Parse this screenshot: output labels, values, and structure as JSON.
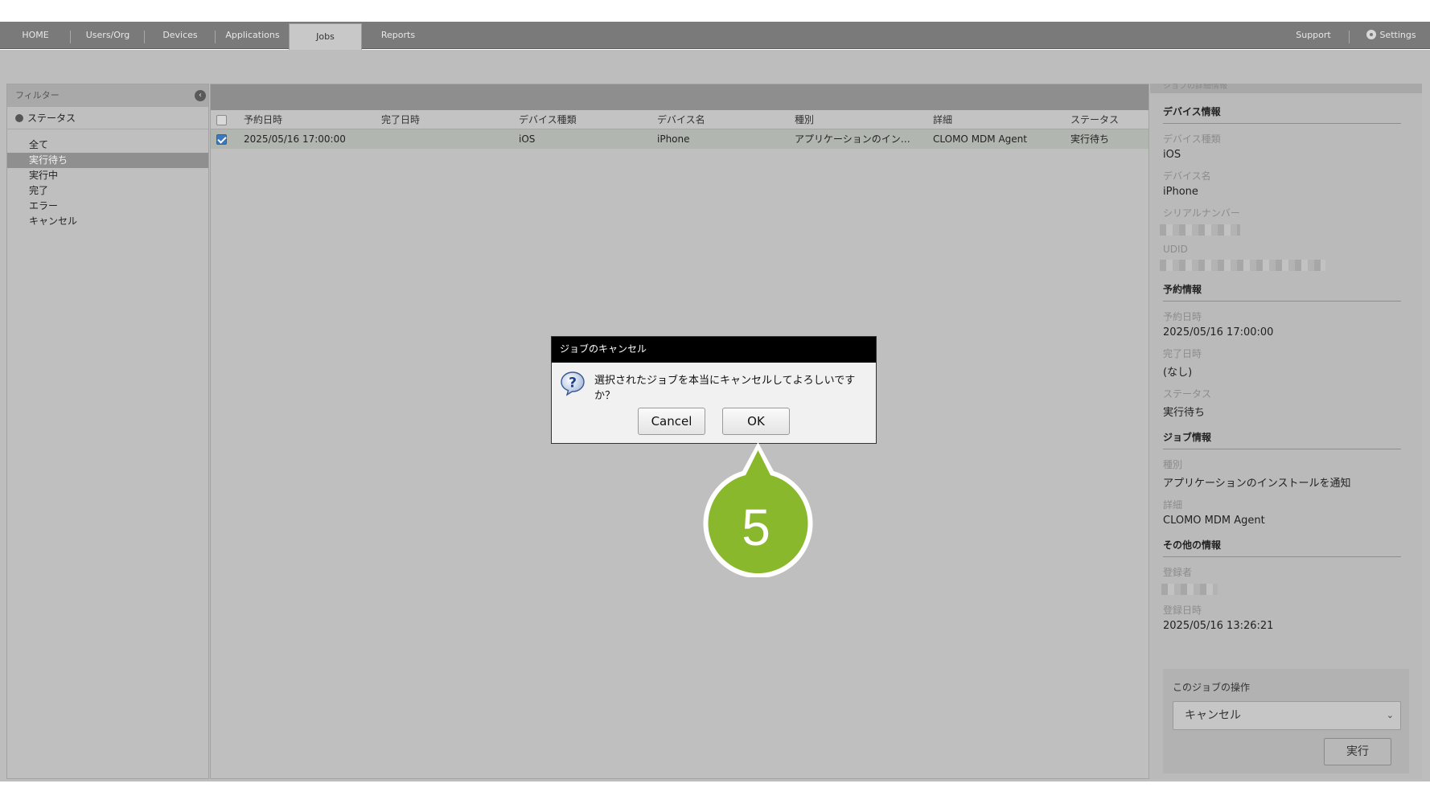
{
  "nav": {
    "tabs": [
      "HOME",
      "Users/Org",
      "Devices",
      "Applications",
      "Jobs",
      "Reports"
    ],
    "active": "Jobs",
    "support": "Support",
    "settings": "Settings"
  },
  "filter": {
    "header": "フィルター",
    "group": "ステータス",
    "items": [
      "全て",
      "実行待ち",
      "実行中",
      "完了",
      "エラー",
      "キャンセル"
    ],
    "selected": "実行待ち"
  },
  "table": {
    "columns": [
      "予約日時",
      "完了日時",
      "デバイス種類",
      "デバイス名",
      "種別",
      "詳細",
      "ステータス"
    ],
    "rows": [
      {
        "checked": true,
        "scheduled": "2025/05/16 17:00:00",
        "completed": "",
        "device_type": "iOS",
        "device_name": "iPhone",
        "kind": "アプリケーションのイン…",
        "detail": "CLOMO MDM Agent",
        "status": "実行待ち"
      }
    ]
  },
  "detail": {
    "top_partial": "ジョブの詳細情報",
    "device_section": "デバイス情報",
    "device_type_label": "デバイス種類",
    "device_type": "iOS",
    "device_name_label": "デバイス名",
    "device_name": "iPhone",
    "serial_label": "シリアルナンバー",
    "udid_label": "UDID",
    "schedule_section": "予約情報",
    "scheduled_label": "予約日時",
    "scheduled": "2025/05/16 17:00:00",
    "completed_label": "完了日時",
    "completed": "(なし)",
    "status_label": "ステータス",
    "status": "実行待ち",
    "job_section": "ジョブ情報",
    "kind_label": "種別",
    "kind": "アプリケーションのインストールを通知",
    "detail_label": "詳細",
    "detail_value": "CLOMO MDM Agent",
    "other_section": "その他の情報",
    "registrant_label": "登録者",
    "registered_label": "登録日時",
    "registered": "2025/05/16 13:26:21",
    "op_title": "このジョブの操作",
    "op_selected": "キャンセル",
    "op_run": "実行"
  },
  "dialog": {
    "title": "ジョブのキャンセル",
    "message": "選択されたジョブを本当にキャンセルしてよろしいですか？",
    "cancel": "Cancel",
    "ok": "OK"
  },
  "step_badge": "5",
  "colors": {
    "badge_green": "#8ab82c",
    "nav_bg": "#7a7a7a",
    "overlay_gray": "#bdbdbd"
  }
}
